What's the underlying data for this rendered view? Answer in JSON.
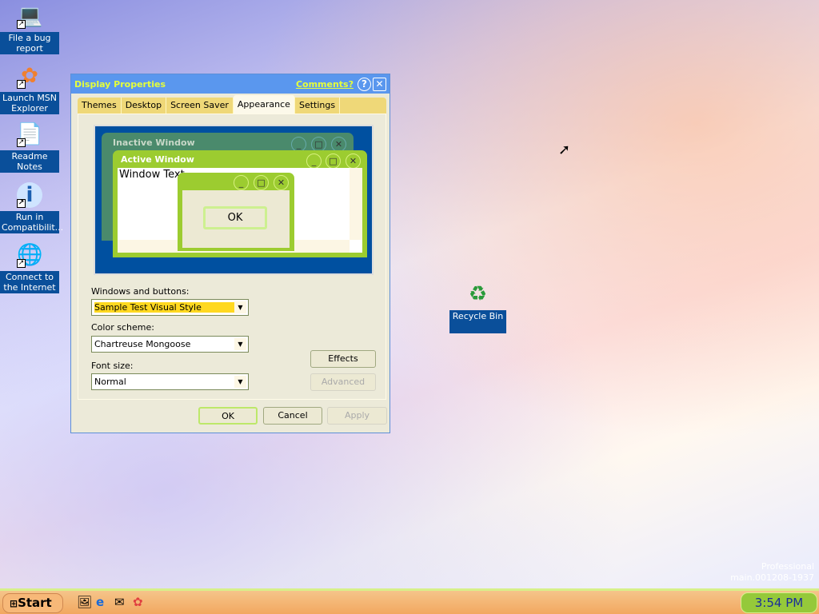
{
  "desktop": {
    "icons": [
      {
        "label": "File a bug report",
        "icon": "bug-report-icon"
      },
      {
        "label": "Launch MSN Explorer",
        "icon": "msn-butterfly-icon"
      },
      {
        "label": "Readme Notes",
        "icon": "readme-document-icon"
      },
      {
        "label": "Run in Compatibilit...",
        "icon": "info-icon"
      },
      {
        "label": "Connect to the Internet",
        "icon": "connect-internet-icon"
      },
      {
        "label": "Recycle Bin",
        "icon": "recycle-bin-icon"
      }
    ],
    "watermark": {
      "line1": "Professional",
      "line2": "main.001208-1937"
    }
  },
  "dialog": {
    "title": "Display Properties",
    "comments": "Comments?",
    "help": "?",
    "close": "✕",
    "tabs": [
      "Themes",
      "Desktop",
      "Screen Saver",
      "Appearance",
      "Settings"
    ],
    "active_tab": "Appearance",
    "preview": {
      "inactive": "Inactive Window",
      "active": "Active Window",
      "window_text": "Window Text",
      "ok": "OK"
    },
    "windows_buttons_label": "Windows and buttons:",
    "windows_buttons_value": "Sample Test Visual Style",
    "color_scheme_label": "Color scheme:",
    "color_scheme_value": "Chartreuse Mongoose",
    "font_size_label": "Font size:",
    "font_size_value": "Normal",
    "effects": "Effects",
    "advanced": "Advanced",
    "ok": "OK",
    "cancel": "Cancel",
    "apply": "Apply"
  },
  "taskbar": {
    "start": "Start",
    "clock": "3:54 PM",
    "quick_launch": [
      "show-desktop-icon",
      "internet-explorer-icon",
      "outlook-express-icon",
      "msn-icon"
    ]
  },
  "colors": {
    "taskbar": "#f2a860",
    "title": "#5a97ee",
    "accent": "#9ccc30",
    "title_text": "#e6ff3a"
  }
}
